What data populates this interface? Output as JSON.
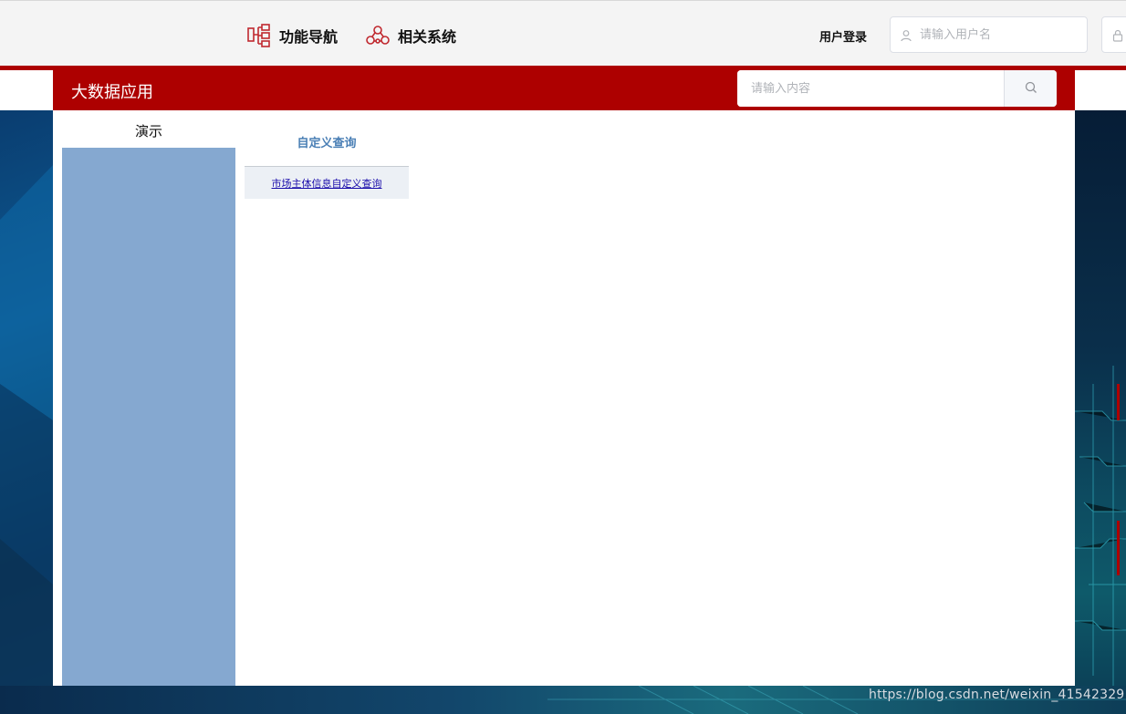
{
  "header": {
    "nav": [
      {
        "label": "功能导航",
        "icon": "hierarchy-icon"
      },
      {
        "label": "相关系统",
        "icon": "nodes-cluster-icon"
      }
    ],
    "login_label": "用户登录",
    "username_placeholder": "请输入用户名",
    "password_placeholder": ""
  },
  "panel": {
    "title": "大数据应用",
    "search_placeholder": "请输入内容",
    "sidebar_title": "演示",
    "menu_header": "自定义查询",
    "menu_links": [
      "市场主体信息自定义查询"
    ]
  },
  "watermark": "https://blog.csdn.net/weixin_41542329",
  "colors": {
    "brand_red": "#ad0000",
    "sidebar_blue": "#85a8d0",
    "menu_header_blue": "#4a7fb5",
    "link_blue": "#1a0dab"
  }
}
